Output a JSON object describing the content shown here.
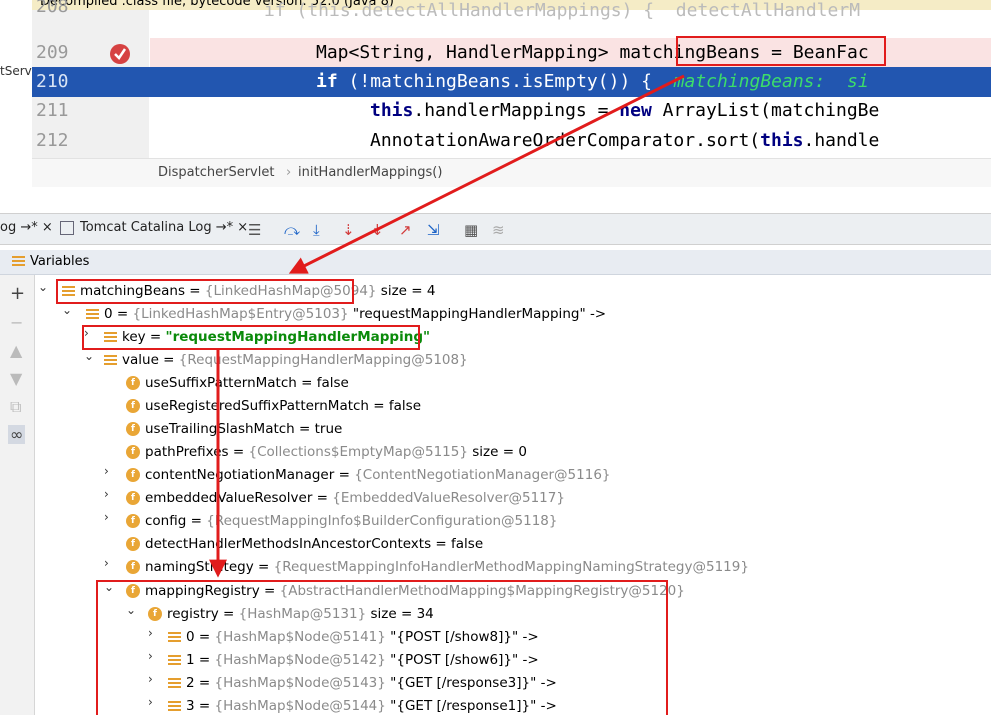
{
  "banner": {
    "text": "Decompiled .class file, bytecode version: 52.0 (Java 8)"
  },
  "editor": {
    "lines": [
      {
        "num": "208",
        "text": "if (this.detectAllHandlerMappings) {  detectAllHandlerM"
      },
      {
        "num": "209",
        "text_a": "Map<String, HandlerMapping> ",
        "text_b": "matchingBeans",
        "text_c": " = BeanFac"
      },
      {
        "num": "210",
        "kw": "if",
        "text": " (!matchingBeans.isEmpty()) {  ",
        "hint": "matchingBeans:  si"
      },
      {
        "num": "211",
        "kw1": "this",
        "text1": ".handlerMappings = ",
        "kw2": "new",
        "text2": " ArrayList(matchingBe"
      },
      {
        "num": "212",
        "text1": "AnnotationAwareOrderComparator.sort(",
        "kw": "this",
        "text2": ".handle"
      }
    ],
    "left_partial": "tServ"
  },
  "breadcrumb": {
    "class_name": "DispatcherServlet",
    "separator": "›",
    "method": "initHandlerMappings()"
  },
  "tabs": [
    {
      "label": "og →*",
      "close": "×"
    },
    {
      "label": "Tomcat Catalina Log →*",
      "close": "×"
    }
  ],
  "variables": {
    "title": "Variables",
    "rows": [
      {
        "name": "matchingBeans",
        "eq": " = ",
        "type": "{LinkedHashMap@5094}",
        "extra": " size = 4"
      },
      {
        "name": "0",
        "eq": " = ",
        "type": "{LinkedHashMap$Entry@5103}",
        "extra": " \"requestMappingHandlerMapping\" ->"
      },
      {
        "name": "key",
        "eq": " = ",
        "value": "\"requestMappingHandlerMapping\""
      },
      {
        "name": "value",
        "eq": " = ",
        "type": "{RequestMappingHandlerMapping@5108}"
      },
      {
        "name": "useSuffixPatternMatch",
        "eq": " = ",
        "extra": "false"
      },
      {
        "name": "useRegisteredSuffixPatternMatch",
        "eq": " = ",
        "extra": "false"
      },
      {
        "name": "useTrailingSlashMatch",
        "eq": " = ",
        "extra": "true"
      },
      {
        "name": "pathPrefixes",
        "eq": " = ",
        "type": "{Collections$EmptyMap@5115}",
        "extra": "  size = 0"
      },
      {
        "name": "contentNegotiationManager",
        "eq": " = ",
        "type": "{ContentNegotiationManager@5116}"
      },
      {
        "name": "embeddedValueResolver",
        "eq": " = ",
        "type": "{EmbeddedValueResolver@5117}"
      },
      {
        "name": "config",
        "eq": " = ",
        "type": "{RequestMappingInfo$BuilderConfiguration@5118}"
      },
      {
        "name": "detectHandlerMethodsInAncestorContexts",
        "eq": " = ",
        "extra": "false"
      },
      {
        "name": "namingStrategy",
        "eq": " = ",
        "type": "{RequestMappingInfoHandlerMethodMappingNamingStrategy@5119}"
      },
      {
        "name": "mappingRegistry",
        "eq": " = ",
        "type": "{AbstractHandlerMethodMapping$MappingRegistry@5120}"
      },
      {
        "name": "registry",
        "eq": " = ",
        "type": "{HashMap@5131}",
        "extra": "  size = 34"
      },
      {
        "name": "0",
        "eq": " = ",
        "type": "{HashMap$Node@5141}",
        "extra": " \"{POST [/show8]}\" ->"
      },
      {
        "name": "1",
        "eq": " = ",
        "type": "{HashMap$Node@5142}",
        "extra": " \"{POST [/show6]}\" ->"
      },
      {
        "name": "2",
        "eq": " = ",
        "type": "{HashMap$Node@5143}",
        "extra": " \"{GET [/response3]}\" ->"
      },
      {
        "name": "3",
        "eq": " = ",
        "type": "{HashMap$Node@5144}",
        "extra": " \"{GET [/response1]}\" ->"
      }
    ]
  },
  "colors": {
    "annotation": "#e11c1c",
    "current_line": "#2256b0",
    "breakpoint_line": "#fae3e3"
  }
}
